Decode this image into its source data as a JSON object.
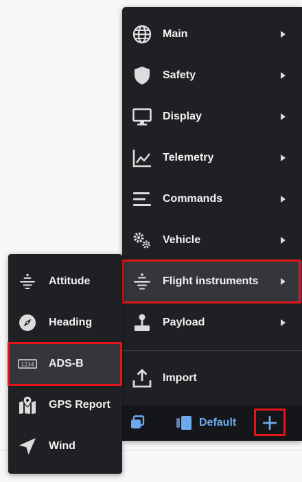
{
  "main_menu": {
    "items": [
      {
        "label": "Main",
        "icon": "globe-icon"
      },
      {
        "label": "Safety",
        "icon": "shield-icon"
      },
      {
        "label": "Display",
        "icon": "monitor-icon"
      },
      {
        "label": "Telemetry",
        "icon": "chart-line-icon"
      },
      {
        "label": "Commands",
        "icon": "lines-icon"
      },
      {
        "label": "Vehicle",
        "icon": "gears-icon"
      },
      {
        "label": "Flight instruments",
        "icon": "attitude-icon"
      },
      {
        "label": "Payload",
        "icon": "joystick-icon"
      }
    ],
    "import_label": "Import",
    "active_item": "Flight instruments"
  },
  "footer": {
    "profile_label": "Default",
    "add_icon": "plus-icon",
    "left_icon": "layers-icon",
    "profile_icon": "panels-icon"
  },
  "submenu": {
    "items": [
      {
        "label": "Attitude",
        "icon": "attitude-icon"
      },
      {
        "label": "Heading",
        "icon": "compass-icon"
      },
      {
        "label": "ADS-B",
        "icon": "adsb-display-icon"
      },
      {
        "label": "GPS Report",
        "icon": "map-pin-icon"
      },
      {
        "label": "Wind",
        "icon": "navigation-arrow-icon"
      }
    ],
    "adsb_display_text": "1234",
    "active_item": "ADS-B"
  },
  "colors": {
    "menu_bg": "#1f2023",
    "footer_bg": "#151619",
    "active_bg": "#35363b",
    "highlight": "#e3151a",
    "accent": "#6ea9ec",
    "text": "#f2f2f2",
    "icon": "#dcdcdc"
  }
}
